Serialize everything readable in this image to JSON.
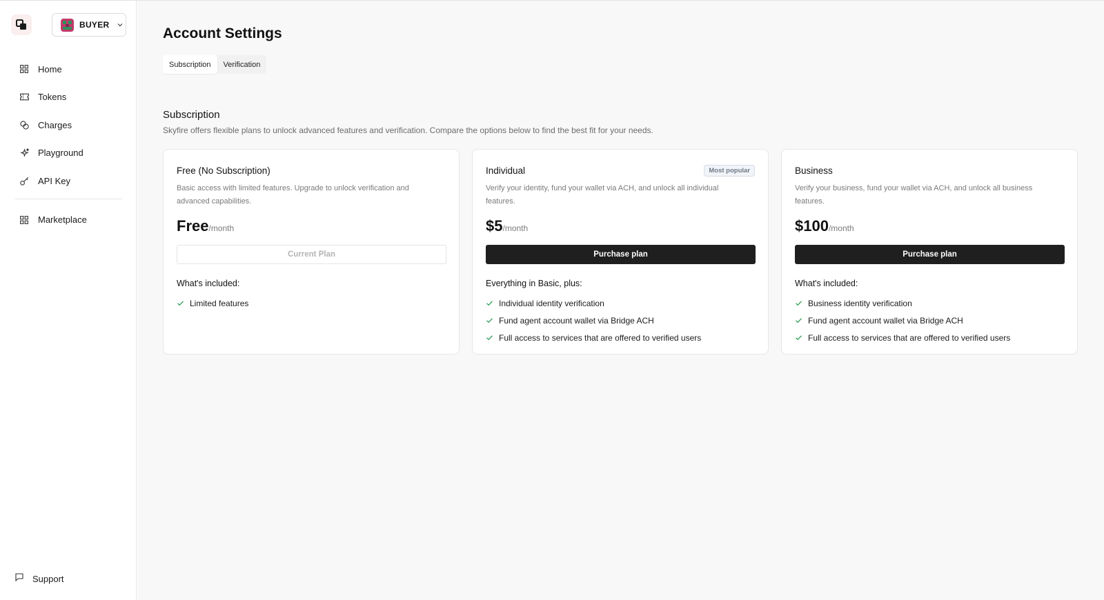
{
  "sidebar": {
    "role": {
      "label": "BUYER"
    },
    "nav": [
      {
        "label": "Home",
        "icon": "grid-icon"
      },
      {
        "label": "Tokens",
        "icon": "ticket-icon"
      },
      {
        "label": "Charges",
        "icon": "coins-icon"
      },
      {
        "label": "Playground",
        "icon": "sparkle-icon"
      },
      {
        "label": "API Key",
        "icon": "key-icon"
      }
    ],
    "nav_secondary": [
      {
        "label": "Marketplace",
        "icon": "grid-icon"
      }
    ],
    "support": {
      "label": "Support",
      "icon": "message-icon"
    }
  },
  "main": {
    "title": "Account Settings",
    "tabs": [
      {
        "label": "Subscription",
        "active": true
      },
      {
        "label": "Verification",
        "active": false
      }
    ],
    "section": {
      "title": "Subscription",
      "description": "Skyfire offers flexible plans to unlock advanced features and verification. Compare the options below to find the best fit for your needs."
    },
    "plans": [
      {
        "name": "Free (No Subscription)",
        "badge": "",
        "description": "Basic access with limited features. Upgrade to unlock verification and advanced capabilities.",
        "price": "Free",
        "period": "/month",
        "button": "Current Plan",
        "included_title": "What's included:",
        "features": [
          "Limited features"
        ]
      },
      {
        "name": "Individual",
        "badge": "Most popular",
        "description": "Verify your identity, fund your wallet via ACH, and unlock all individual features.",
        "price": "$5",
        "period": "/month",
        "button": "Purchase plan",
        "included_title": "Everything in Basic, plus:",
        "features": [
          "Individual identity verification",
          "Fund agent account wallet via Bridge ACH",
          "Full access to services that are offered to verified users"
        ]
      },
      {
        "name": "Business",
        "badge": "",
        "description": "Verify your business, fund your wallet via ACH, and unlock all business features.",
        "price": "$100",
        "period": "/month",
        "button": "Purchase plan",
        "included_title": "What's included:",
        "features": [
          "Business identity verification",
          "Fund agent account wallet via Bridge ACH",
          "Full access to services that are offered to verified users"
        ]
      }
    ]
  },
  "colors": {
    "accent_dark": "#1f1f1f",
    "check_green": "#2e9e58",
    "badge_text": "#6f7a86"
  }
}
